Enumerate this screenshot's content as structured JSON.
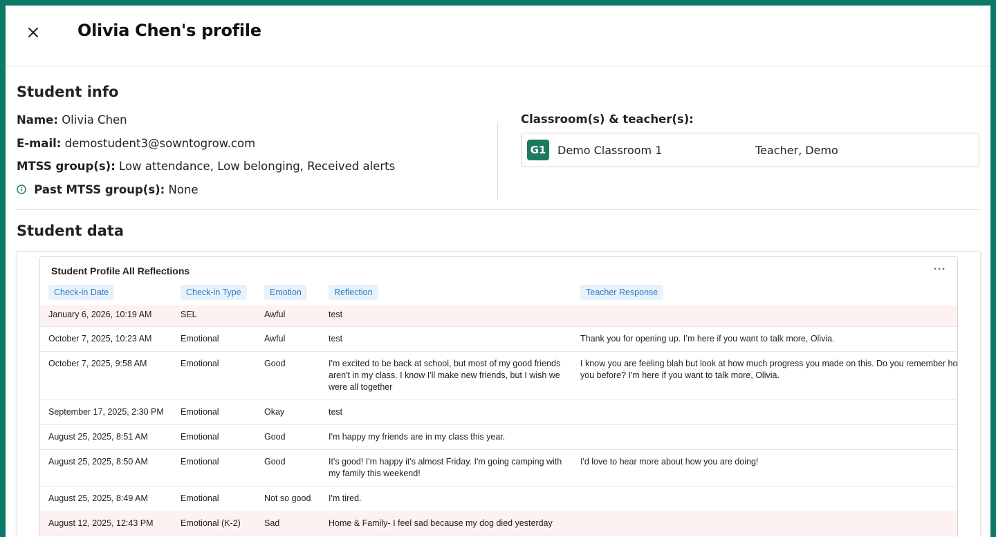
{
  "header": {
    "title": "Olivia Chen's profile",
    "close_icon": "close-icon"
  },
  "student_info": {
    "heading": "Student info",
    "name_label": "Name:",
    "name_value": "Olivia Chen",
    "email_label": "E-mail:",
    "email_value": "demostudent3@sowntogrow.com",
    "mtss_label": "MTSS group(s):",
    "mtss_value": "Low attendance, Low belonging, Received alerts",
    "past_mtss_label": "Past MTSS group(s):",
    "past_mtss_value": "None",
    "classrooms_label": "Classroom(s) & teacher(s):",
    "classroom": {
      "badge": "G1",
      "name": "Demo Classroom 1",
      "teacher": "Teacher, Demo",
      "badge_color": "#1b7a5f"
    }
  },
  "student_data": {
    "heading": "Student data",
    "report_title": "Student Profile All Reflections",
    "columns": [
      "Check-in Date",
      "Check-in Type",
      "Emotion",
      "Reflection",
      "Teacher Response"
    ],
    "rows": [
      {
        "date": "January 6, 2026, 10:19 AM",
        "type": "SEL",
        "emotion": "Awful",
        "reflection": "test",
        "response": "",
        "highlight": true
      },
      {
        "date": "October 7, 2025, 10:23 AM",
        "type": "Emotional",
        "emotion": "Awful",
        "reflection": "test",
        "response": "Thank you for opening up. I’m here if you want to talk more, Olivia.",
        "highlight": false
      },
      {
        "date": "October 7, 2025, 9:58 AM",
        "type": "Emotional",
        "emotion": "Good",
        "reflection": "I'm excited to be back at school, but most of my good friends aren't in my class. I know I'll make new friends, but I wish we were all together",
        "response": "I know you are feeling blah but look at how much progress you made on this. Do you remember how you before? I'm here if you want to talk more, Olivia.",
        "highlight": false
      },
      {
        "date": "September 17, 2025, 2:30 PM",
        "type": "Emotional",
        "emotion": "Okay",
        "reflection": "test",
        "response": "",
        "highlight": false
      },
      {
        "date": "August 25, 2025, 8:51 AM",
        "type": "Emotional",
        "emotion": "Good",
        "reflection": "I'm happy my friends are in my class this year.",
        "response": "",
        "highlight": false
      },
      {
        "date": "August 25, 2025, 8:50 AM",
        "type": "Emotional",
        "emotion": "Good",
        "reflection": "It's good! I'm happy it's almost Friday. I'm going camping with my family this weekend!",
        "response": "I'd love to hear more about how you are doing!",
        "highlight": false
      },
      {
        "date": "August 25, 2025, 8:49 AM",
        "type": "Emotional",
        "emotion": "Not so good",
        "reflection": "I'm tired.",
        "response": "",
        "highlight": false
      },
      {
        "date": "August 12, 2025, 12:43 PM",
        "type": "Emotional (K-2)",
        "emotion": "Sad",
        "reflection": "Home & Family- I feel sad because my dog died yesterday",
        "response": "",
        "highlight": true
      }
    ]
  },
  "colors": {
    "frame": "#0b7a68",
    "header_chip_bg": "#e8f2fb",
    "header_chip_text": "#2c7ccb",
    "highlight_row": "#fdf1f1"
  }
}
